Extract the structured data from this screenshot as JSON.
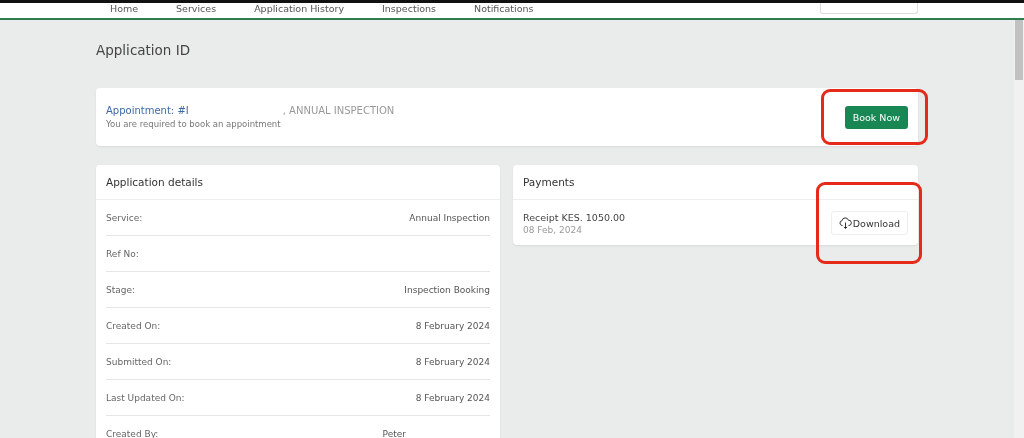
{
  "nav": {
    "items": [
      {
        "label": "Home"
      },
      {
        "label": "Services"
      },
      {
        "label": "Application History"
      },
      {
        "label": "Inspections"
      },
      {
        "label": "Notifications"
      }
    ]
  },
  "page_title": "Application ID",
  "appointment": {
    "label": "Appointment: #I",
    "type": ", ANNUAL INSPECTION",
    "note": "You are required to book an appointment",
    "button": "Book Now",
    "highlighted": true
  },
  "details": {
    "title": "Application details",
    "rows": [
      {
        "label": "Service:",
        "value": "Annual Inspection"
      },
      {
        "label": "Ref No:",
        "value": ""
      },
      {
        "label": "Stage:",
        "value": "Inspection Booking"
      },
      {
        "label": "Created On:",
        "value": "8 February 2024"
      },
      {
        "label": "Submitted On:",
        "value": "8 February 2024"
      },
      {
        "label": "Last Updated On:",
        "value": "8 February 2024"
      },
      {
        "label": "Created By:",
        "value": "Peter",
        "kind": "name"
      }
    ]
  },
  "payments": {
    "title": "Payments",
    "items": [
      {
        "label": "Receipt KES. 1050.00",
        "date": "08 Feb, 2024",
        "button": "Download",
        "highlighted": true
      }
    ]
  }
}
